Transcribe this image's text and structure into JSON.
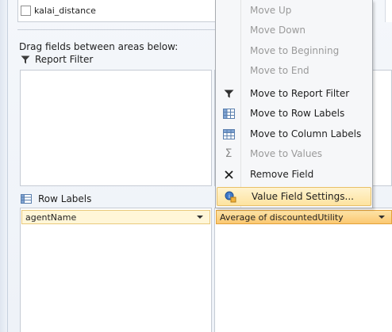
{
  "field_list": {
    "field_label": "kalai_distance"
  },
  "areas": {
    "drag_hint": "Drag fields between areas below:",
    "report_filter_label": "Report Filter",
    "row_labels_label": "Row Labels",
    "row_field_value": "agentName",
    "values_field_value": "Average of discountedUtility"
  },
  "context_menu": {
    "items": [
      {
        "label": "Move Up",
        "icon": "",
        "enabled": false
      },
      {
        "label": "Move Down",
        "icon": "",
        "enabled": false
      },
      {
        "label": "Move to Beginning",
        "icon": "",
        "enabled": false
      },
      {
        "label": "Move to End",
        "icon": "",
        "enabled": false
      },
      {
        "label": "Move to Report Filter",
        "icon": "filter-icon",
        "enabled": true
      },
      {
        "label": "Move to Row Labels",
        "icon": "row-labels-icon",
        "enabled": true
      },
      {
        "label": "Move to Column Labels",
        "icon": "column-labels-icon",
        "enabled": true
      },
      {
        "label": "Move to Values",
        "icon": "sigma-icon",
        "enabled": false
      },
      {
        "label": "Remove Field",
        "icon": "remove-icon",
        "enabled": true
      },
      {
        "label": "Value Field Settings...",
        "icon": "value-settings-icon",
        "enabled": true,
        "highlighted": true
      }
    ]
  },
  "colors": {
    "highlight_fill": "#fde3a0",
    "value_field_fill": "#fbc871",
    "row_field_fill": "#fff6d8"
  }
}
